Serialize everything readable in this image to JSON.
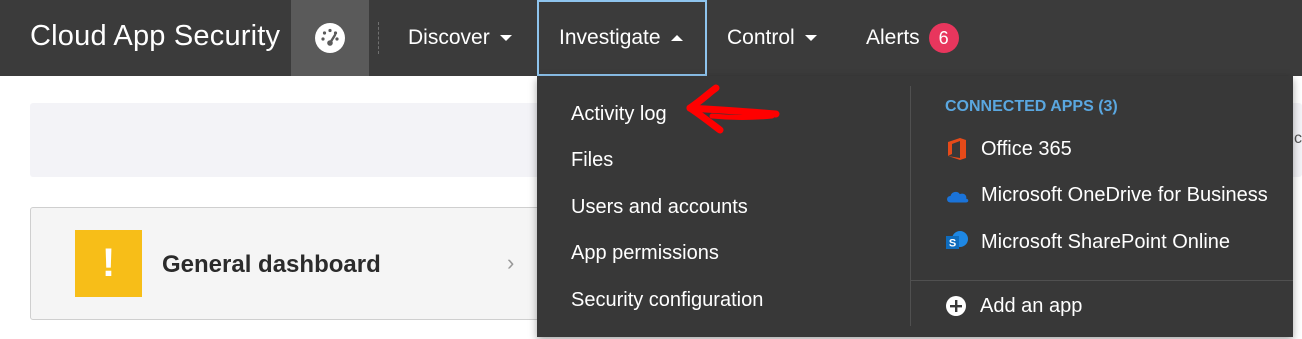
{
  "brand": "Cloud App Security",
  "icons": {
    "dashboard": "speedometer-icon",
    "alert": "exclamation-icon",
    "office365": "office-icon",
    "onedrive": "cloud-icon",
    "sharepoint": "sharepoint-icon",
    "add": "plus-circle-icon",
    "annotation": "red-arrow-icon"
  },
  "nav": {
    "discover": "Discover",
    "investigate": "Investigate",
    "control": "Control",
    "alerts": "Alerts",
    "alerts_count": "6"
  },
  "investigate_menu": {
    "items": [
      "Activity log",
      "Files",
      "Users and accounts",
      "App permissions",
      "Security configuration"
    ],
    "connected_apps_header": "CONNECTED APPS (3)",
    "apps": [
      "Office 365",
      "Microsoft OneDrive for Business",
      "Microsoft SharePoint Online"
    ],
    "add_app": "Add an app"
  },
  "dashboard_card": {
    "title": "General dashboard",
    "icon_glyph": "!",
    "chevron": "›"
  },
  "right_stub": "c",
  "colors": {
    "topbar": "#3b3b3b",
    "dropdown": "#383838",
    "accent_blue": "#5aa7e0",
    "badge_red": "#e8365d",
    "warning_yellow": "#f7be18",
    "office_orange": "#e64a19",
    "onedrive_blue": "#1a73d9",
    "sharepoint_blue": "#0f6cbd",
    "annotation_red": "#ff0000"
  }
}
